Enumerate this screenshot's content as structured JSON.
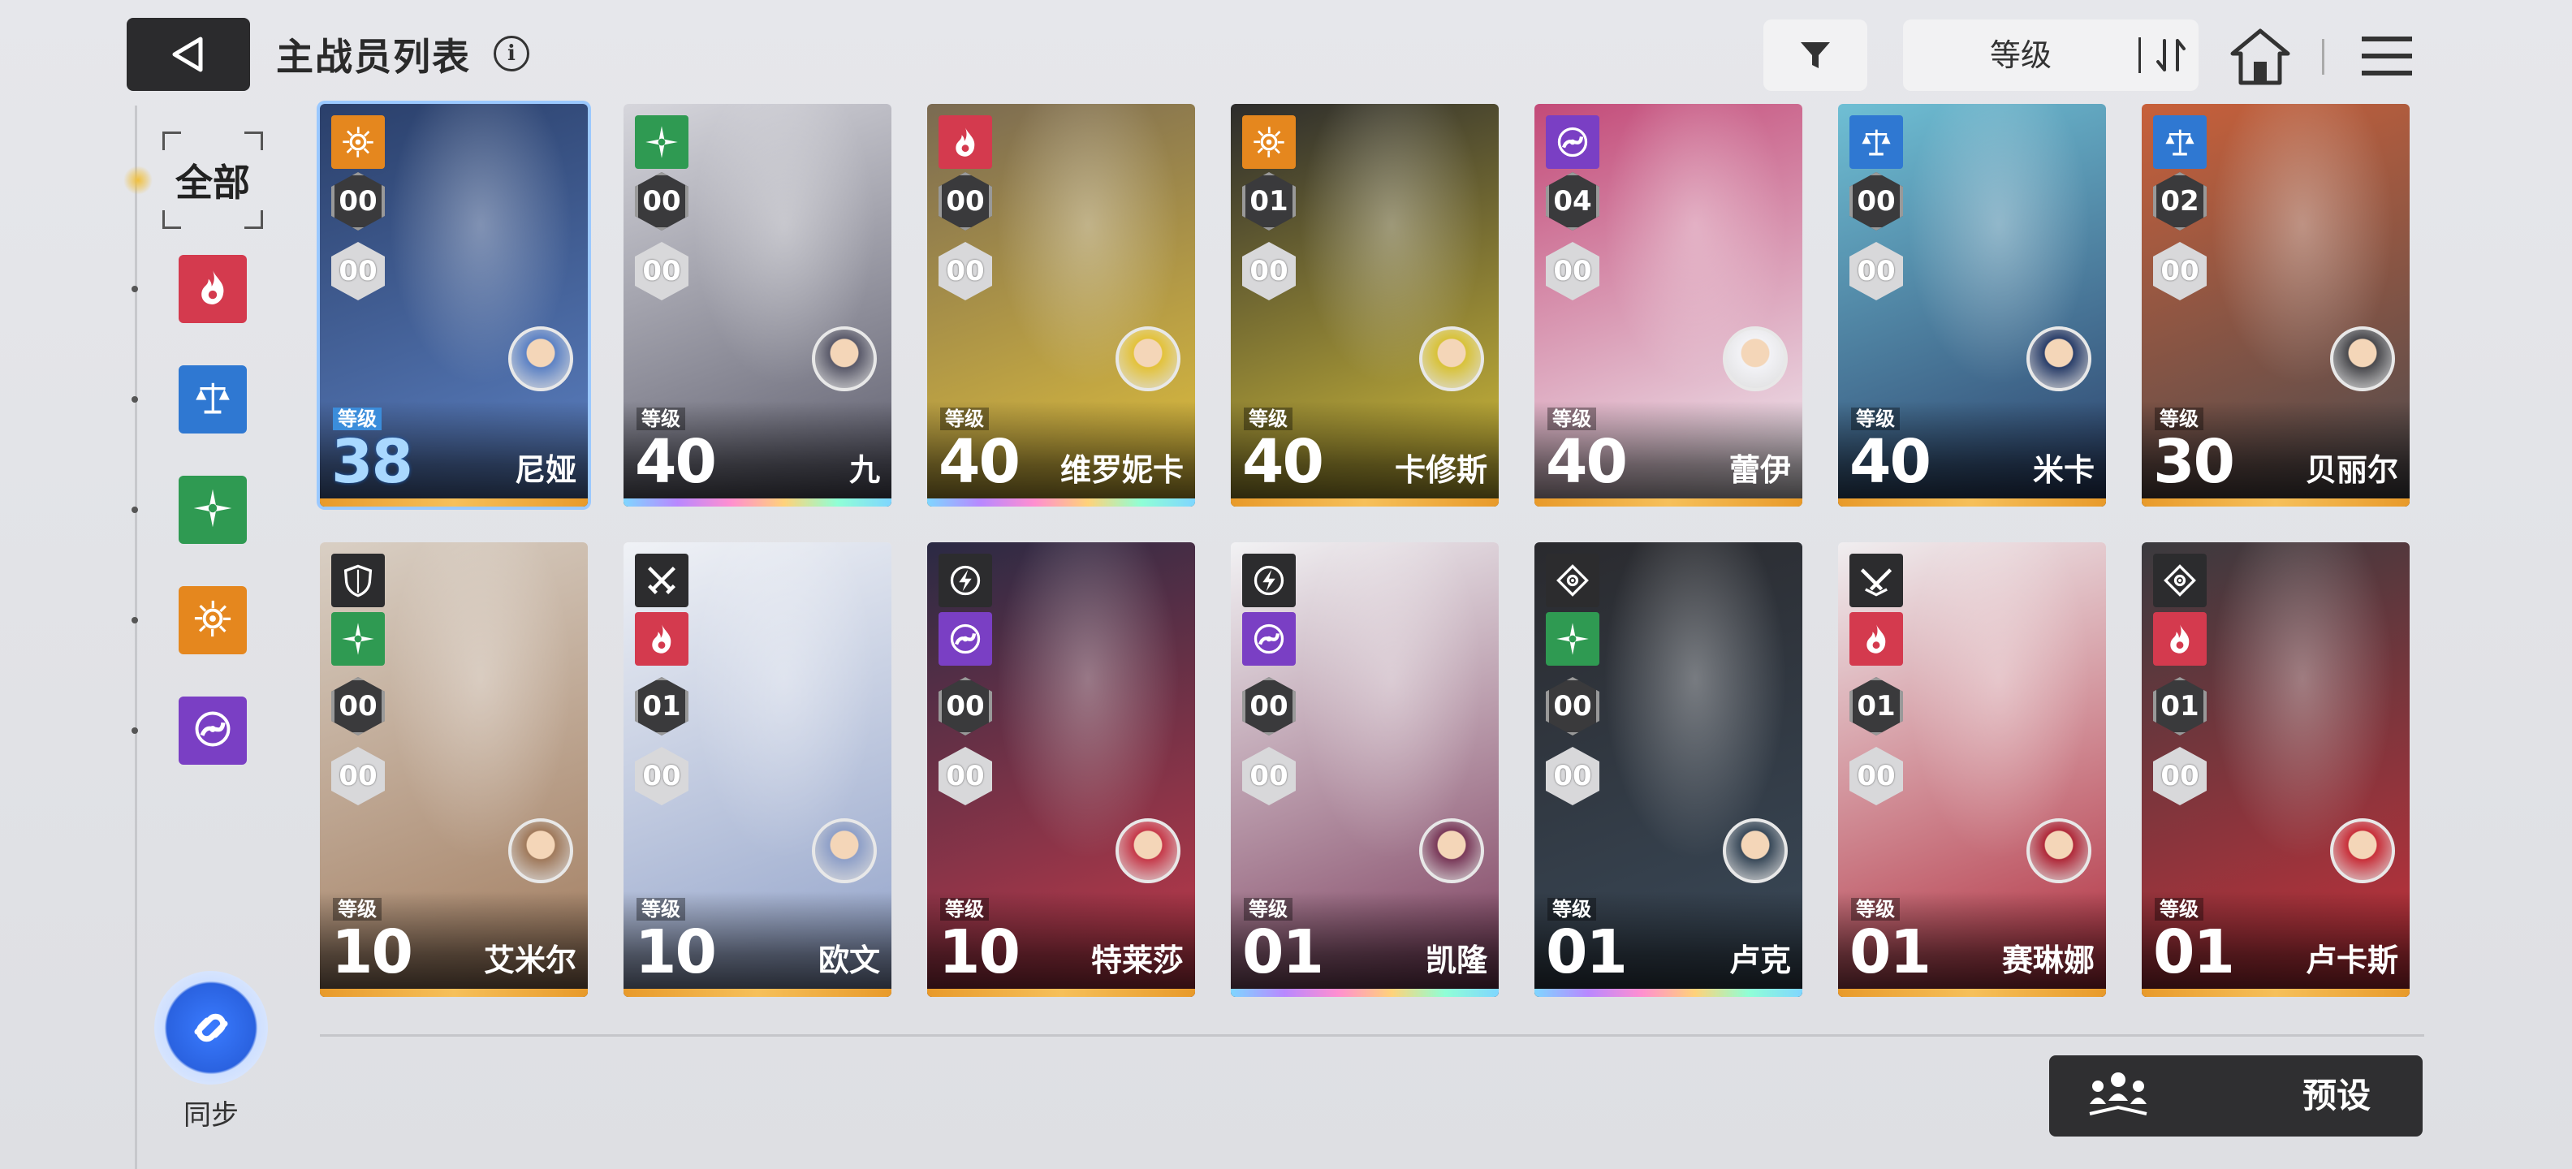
{
  "header": {
    "title": "主战员列表",
    "info": "i",
    "sort_label": "等级"
  },
  "sidebar": {
    "all_label": "全部",
    "filters": [
      {
        "name": "fire",
        "color": "#d43a4e"
      },
      {
        "name": "balance",
        "color": "#2f78d2"
      },
      {
        "name": "star",
        "color": "#2f9a52"
      },
      {
        "name": "sun",
        "color": "#e5871e"
      },
      {
        "name": "void",
        "color": "#7a3fc4"
      }
    ],
    "sync_label": "同步"
  },
  "level_caption": "等级",
  "cards": [
    {
      "name": "尼娅",
      "level": "38",
      "rank": "00",
      "sub": "00",
      "element": "sun",
      "rarity": "gold",
      "selected": true,
      "art": [
        "#2a3f6a",
        "#5d82c4"
      ]
    },
    {
      "name": "九",
      "level": "40",
      "rank": "00",
      "sub": "00",
      "element": "star",
      "rarity": "rainbow",
      "art": [
        "#d6d6dc",
        "#5a5a6a"
      ]
    },
    {
      "name": "维罗妮卡",
      "level": "40",
      "rank": "00",
      "sub": "00",
      "element": "fire",
      "rarity": "rainbow",
      "art": [
        "#7a6a52",
        "#e3c23b"
      ]
    },
    {
      "name": "卡修斯",
      "level": "40",
      "rank": "01",
      "sub": "00",
      "element": "sun",
      "rarity": "gold",
      "art": [
        "#2c2c2c",
        "#d8c23a"
      ]
    },
    {
      "name": "蕾伊",
      "level": "40",
      "rank": "04",
      "sub": "00",
      "element": "void",
      "rarity": "gold",
      "art": [
        "#c34a78",
        "#f2f2f6"
      ]
    },
    {
      "name": "米卡",
      "level": "40",
      "rank": "00",
      "sub": "00",
      "element": "balance",
      "rarity": "gold",
      "art": [
        "#6fbfd4",
        "#2b3f6a"
      ]
    },
    {
      "name": "贝丽尔",
      "level": "30",
      "rank": "02",
      "sub": "00",
      "element": "balance",
      "rarity": "gold",
      "art": [
        "#c8603a",
        "#4a4a4e"
      ]
    },
    {
      "name": "艾米尔",
      "level": "10",
      "rank": "00",
      "sub": "00",
      "element": "star",
      "role": "shield",
      "rarity": "gold",
      "art": [
        "#d9cfc4",
        "#a07a5c"
      ]
    },
    {
      "name": "欧文",
      "level": "10",
      "rank": "01",
      "sub": "00",
      "element": "fire",
      "role": "swords",
      "rarity": "gold",
      "art": [
        "#f0f2f6",
        "#8fa0c8"
      ]
    },
    {
      "name": "特莱莎",
      "level": "10",
      "rank": "00",
      "sub": "00",
      "element": "void",
      "role": "bolt",
      "rarity": "gold",
      "art": [
        "#2a2a44",
        "#c63a4a"
      ]
    },
    {
      "name": "凯隆",
      "level": "01",
      "rank": "00",
      "sub": "00",
      "element": "void",
      "role": "bolt",
      "rarity": "rainbow",
      "art": [
        "#f2f2f4",
        "#7a3a5a"
      ]
    },
    {
      "name": "卢克",
      "level": "01",
      "rank": "00",
      "sub": "00",
      "element": "star",
      "role": "target",
      "rarity": "rainbow",
      "art": [
        "#2a2a2e",
        "#3a4a5a"
      ]
    },
    {
      "name": "赛琳娜",
      "level": "01",
      "rank": "01",
      "sub": "00",
      "element": "fire",
      "role": "swords2",
      "rarity": "gold",
      "art": [
        "#f0eef0",
        "#b02a3a"
      ]
    },
    {
      "name": "卢卡斯",
      "level": "01",
      "rank": "01",
      "sub": "00",
      "element": "fire",
      "role": "target",
      "rarity": "gold",
      "art": [
        "#3a3a3e",
        "#c8303a"
      ]
    }
  ],
  "preset_label": "预设"
}
